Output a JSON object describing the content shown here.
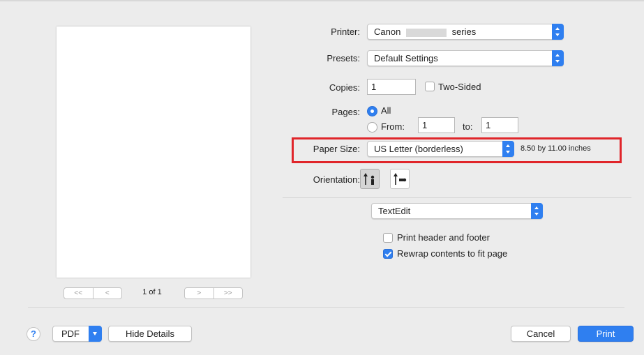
{
  "preview": {
    "page_indicator": "1 of 1",
    "first_label": "<<",
    "prev_label": "<",
    "next_label": ">",
    "last_label": ">>"
  },
  "printer": {
    "label": "Printer:",
    "value_prefix": "Canon",
    "value_suffix": "series"
  },
  "presets": {
    "label": "Presets:",
    "value": "Default Settings"
  },
  "copies": {
    "label": "Copies:",
    "value": "1",
    "two_sided_label": "Two-Sided",
    "two_sided_checked": false
  },
  "pages": {
    "label": "Pages:",
    "all_label": "All",
    "from_label": "From:",
    "from_value": "1",
    "to_label": "to:",
    "to_value": "1",
    "selected": "All"
  },
  "paper_size": {
    "label": "Paper Size:",
    "value": "US Letter (borderless)",
    "dimensions": "8.50 by 11.00 inches"
  },
  "orientation": {
    "label": "Orientation:",
    "selected": "portrait"
  },
  "app_section": {
    "value": "TextEdit",
    "print_header_footer_label": "Print header and footer",
    "print_header_footer_checked": false,
    "rewrap_label": "Rewrap contents to fit page",
    "rewrap_checked": true
  },
  "footer": {
    "help_label": "?",
    "pdf_label": "PDF",
    "hide_details_label": "Hide Details",
    "cancel_label": "Cancel",
    "print_label": "Print"
  },
  "colors": {
    "accent": "#2f7ff0",
    "highlight": "#e0252a",
    "background": "#ececec"
  }
}
